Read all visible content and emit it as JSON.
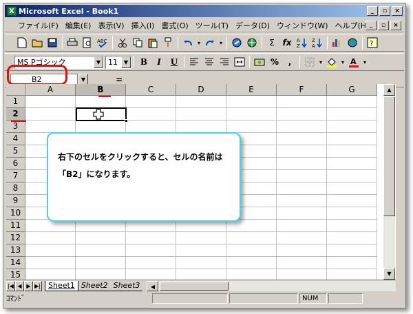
{
  "window": {
    "title": "Microsoft Excel - Book1",
    "minimize": "_",
    "restore": "▫",
    "close": "×"
  },
  "menus": [
    "ファイル(F)",
    "編集(E)",
    "表示(V)",
    "挿入(I)",
    "書式(O)",
    "ツール(T)",
    "データ(D)",
    "ウィンドウ(W)",
    "ヘルプ(H)"
  ],
  "toolbar": {
    "font_name": "MS Pゴシック",
    "font_size": "11",
    "bold": "B",
    "italic": "I",
    "underline": "U",
    "percent": "%",
    "comma": ",",
    "sum": "Σ",
    "fx": "fx"
  },
  "formula_bar": {
    "name_box": "B2",
    "equals": "="
  },
  "columns": [
    "A",
    "B",
    "C",
    "D",
    "E",
    "F",
    "G"
  ],
  "selected_column": "B",
  "rows": [
    "1",
    "2",
    "3",
    "4",
    "5",
    "6",
    "7",
    "8",
    "9",
    "10",
    "11",
    "12",
    "13",
    "14",
    "15"
  ],
  "selected_row": "2",
  "sheets": [
    "Sheet1",
    "Sheet2",
    "Sheet3"
  ],
  "active_sheet": "Sheet1",
  "status": {
    "mode": "ｺﾏﾝﾄﾞ",
    "num": "NUM"
  },
  "callout": {
    "line1": "右下のセルをクリックすると、セルの名前は",
    "line2": "「B2」になります。"
  },
  "colors": {
    "highlight": "#e01010",
    "callout_border": "#4ad0e8",
    "title_start": "#0a246a"
  }
}
